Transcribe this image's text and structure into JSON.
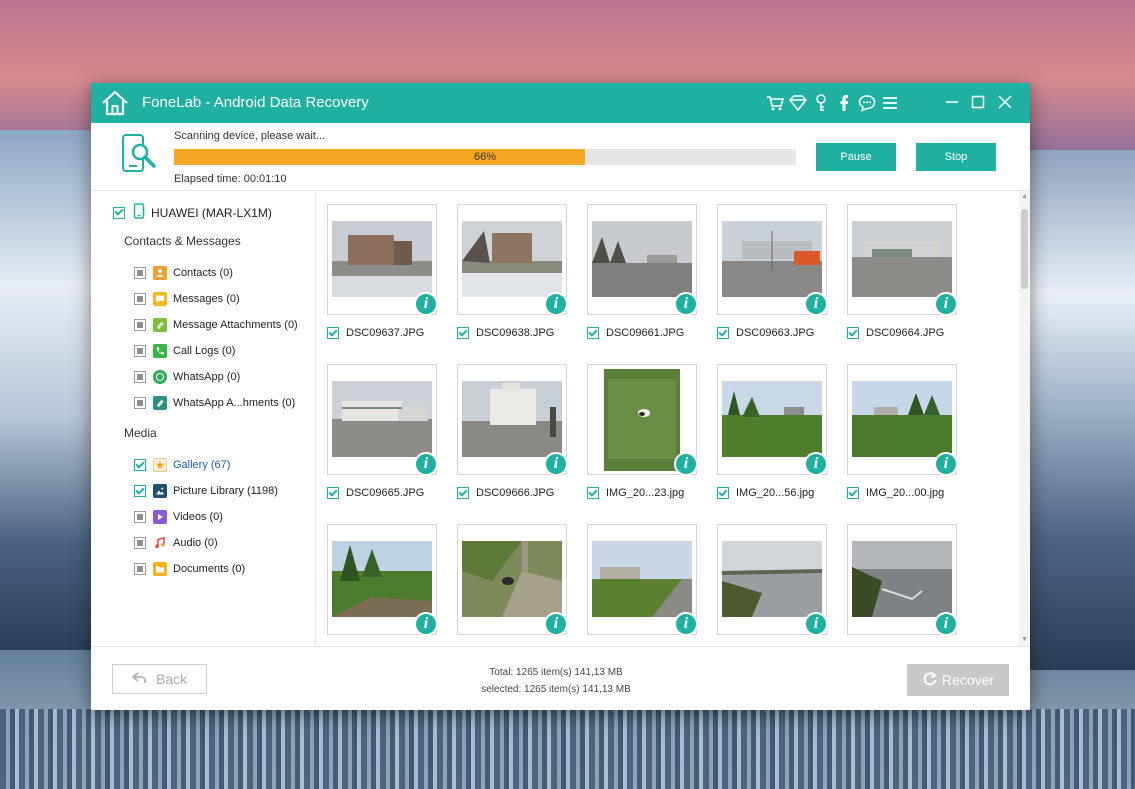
{
  "app": {
    "title": "FoneLab - Android Data Recovery",
    "accent_color": "#1fb0a1",
    "toolbar_icons": [
      "cart-icon",
      "diamond-icon",
      "key-icon",
      "facebook-icon",
      "chat-icon",
      "menu-icon"
    ],
    "window_controls": [
      "minimize-icon",
      "maximize-icon",
      "close-icon"
    ]
  },
  "scan": {
    "status": "Scanning device, please wait...",
    "progress": 66,
    "progress_label": "66%",
    "elapsed": "Elapsed time: 00:01:10",
    "pause_label": "Pause",
    "stop_label": "Stop",
    "progress_color": "#f5a623"
  },
  "sidebar": {
    "device": "HUAWEI (MAR-LX1M)",
    "sections": [
      {
        "title": "Contacts & Messages",
        "items": [
          {
            "label": "Contacts (0)",
            "icon": "contacts-icon",
            "checked": false
          },
          {
            "label": "Messages (0)",
            "icon": "messages-icon",
            "checked": false
          },
          {
            "label": "Message Attachments (0)",
            "icon": "attachment-icon",
            "checked": false
          },
          {
            "label": "Call Logs (0)",
            "icon": "phone-icon",
            "checked": false
          },
          {
            "label": "WhatsApp (0)",
            "icon": "whatsapp-icon",
            "checked": false
          },
          {
            "label": "WhatsApp A...hments (0)",
            "icon": "whatsapp-attachment-icon",
            "checked": false
          }
        ]
      },
      {
        "title": "Media",
        "items": [
          {
            "label": "Gallery (67)",
            "icon": "star-icon",
            "checked": true
          },
          {
            "label": "Picture Library (1198)",
            "icon": "picture-icon",
            "checked": true
          },
          {
            "label": "Videos (0)",
            "icon": "video-icon",
            "checked": false
          },
          {
            "label": "Audio (0)",
            "icon": "music-icon",
            "checked": false
          },
          {
            "label": "Documents (0)",
            "icon": "folder-icon",
            "checked": false
          }
        ]
      }
    ]
  },
  "gallery": {
    "items": [
      {
        "label": "DSC09637.JPG",
        "checked": true
      },
      {
        "label": "DSC09638.JPG",
        "checked": true
      },
      {
        "label": "DSC09661.JPG",
        "checked": true
      },
      {
        "label": "DSC09663.JPG",
        "checked": true
      },
      {
        "label": "DSC09664.JPG",
        "checked": true
      },
      {
        "label": "DSC09665.JPG",
        "checked": true
      },
      {
        "label": "DSC09666.JPG",
        "checked": true
      },
      {
        "label": "IMG_20...23.jpg",
        "checked": true
      },
      {
        "label": "IMG_20...56.jpg",
        "checked": true
      },
      {
        "label": "IMG_20...00.jpg",
        "checked": true
      },
      {
        "label": "",
        "checked": null
      },
      {
        "label": "",
        "checked": null
      },
      {
        "label": "",
        "checked": null
      },
      {
        "label": "",
        "checked": null
      },
      {
        "label": "",
        "checked": null
      }
    ]
  },
  "footer": {
    "back_label": "Back",
    "total": "Total: 1265 item(s) 141,13 MB",
    "selected": "selected: 1265 item(s) 141,13 MB",
    "recover_label": "Recover"
  }
}
